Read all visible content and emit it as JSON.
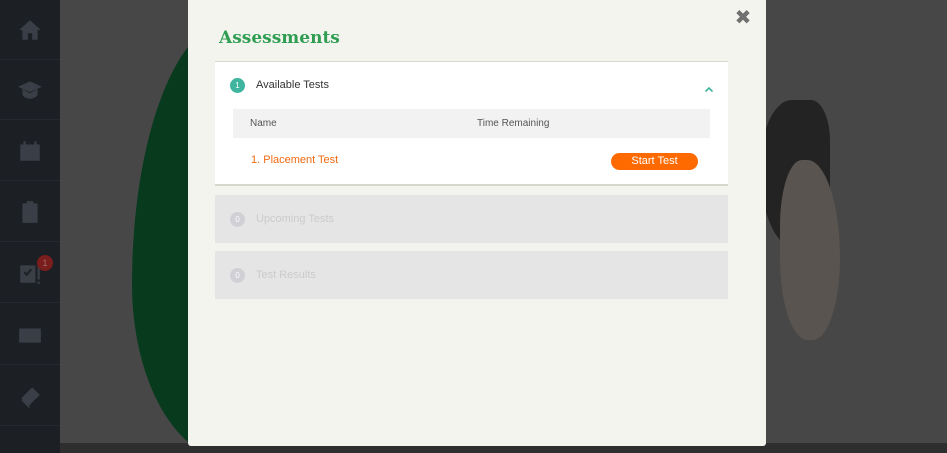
{
  "sidebar": {
    "items": [
      {
        "icon": "home-icon"
      },
      {
        "icon": "graduation-cap-icon"
      },
      {
        "icon": "calendar-icon"
      },
      {
        "icon": "clipboard-icon"
      },
      {
        "icon": "assessment-checklist-icon",
        "badge": "1"
      },
      {
        "icon": "mail-icon"
      },
      {
        "icon": "book-icon"
      }
    ]
  },
  "modal": {
    "title": "Assessments",
    "close_label": "✖",
    "sections": [
      {
        "count": "1",
        "label": "Available Tests",
        "expanded": true,
        "table": {
          "headers": [
            "Name",
            "Time Remaining"
          ],
          "rows": [
            {
              "name": "1. Placement Test",
              "time_remaining": "",
              "action": "Start Test"
            }
          ]
        }
      },
      {
        "count": "0",
        "label": "Upcoming Tests",
        "expanded": false
      },
      {
        "count": "0",
        "label": "Test Results",
        "expanded": false
      }
    ]
  },
  "colors": {
    "title_green": "#2f9e52",
    "accent_orange": "#ff6a00",
    "badge_teal": "#3fb5a0"
  }
}
